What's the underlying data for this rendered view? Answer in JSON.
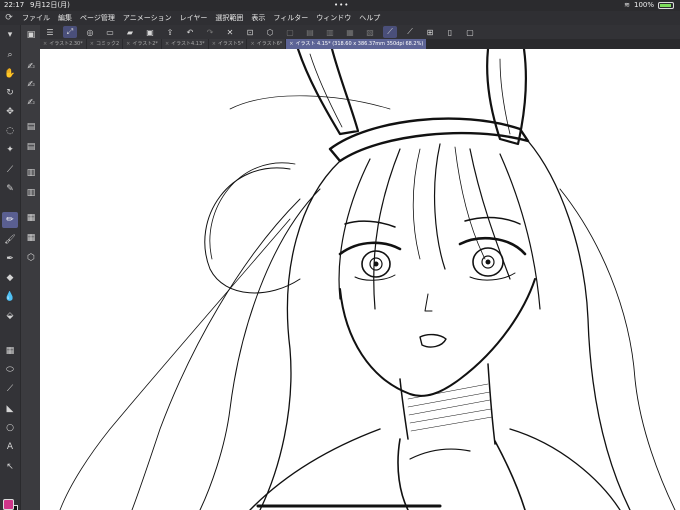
{
  "status": {
    "time": "22:17",
    "date": "9月12日(月)",
    "dots": "•••",
    "battery": "100%"
  },
  "menu": {
    "items": [
      "ファイル",
      "編集",
      "ページ管理",
      "アニメーション",
      "レイヤー",
      "選択範囲",
      "表示",
      "フィルター",
      "ウィンドウ",
      "ヘルプ"
    ]
  },
  "tabs": [
    {
      "label": "イラスト2.30*",
      "active": false
    },
    {
      "label": "コミック2",
      "active": false
    },
    {
      "label": "イラスト2*",
      "active": false
    },
    {
      "label": "イラスト4.13*",
      "active": false
    },
    {
      "label": "イラスト5*",
      "active": false
    },
    {
      "label": "イラスト6*",
      "active": false
    },
    {
      "label": "イラスト 4.15* (318.60 x 386.37mm 350dpi 68.2%)",
      "active": true
    }
  ],
  "colors": {
    "main": "#d0358a",
    "sub": "#111111",
    "accent": "#5d6496"
  },
  "icons": {
    "toolbar": [
      "zoom-icon",
      "hand-icon",
      "rotate-icon",
      "move-icon",
      "lasso-icon",
      "magic-wand-icon",
      "eyedropper-icon",
      "pen-icon",
      "pencil-icon",
      "brush-icon",
      "airbrush-icon",
      "decoration-icon",
      "eraser-icon",
      "blend-icon",
      "fill-icon",
      "gradient-icon",
      "figure-icon",
      "ruler-icon",
      "frame-icon",
      "balloon-icon",
      "text-icon",
      "correct-line-icon"
    ]
  }
}
